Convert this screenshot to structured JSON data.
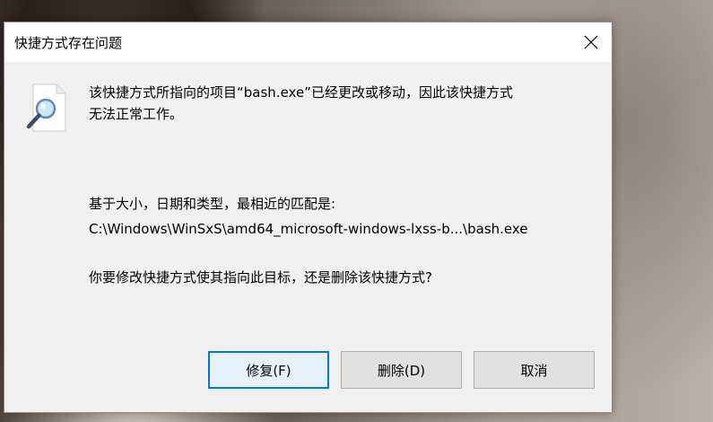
{
  "dialog": {
    "title": "快捷方式存在问题",
    "message_line1": "该快捷方式所指向的项目“bash.exe”已经更改或移动，因此该快捷方式",
    "message_line2": "无法正常工作。",
    "match_label": "基于大小，日期和类型，最相近的匹配是:",
    "match_path": "C:\\Windows\\WinSxS\\amd64_microsoft-windows-lxss-b...\\bash.exe",
    "question": "你要修改快捷方式使其指向此目标，还是删除该快捷方式?",
    "icon": "document-search-icon",
    "close_icon": "close-icon"
  },
  "buttons": {
    "repair": "修复(F)",
    "delete": "删除(D)",
    "cancel": "取消"
  },
  "colors": {
    "accent": "#0078d7",
    "dialog_bg": "#f0f0f0",
    "titlebar_bg": "#ffffff",
    "button_bg": "#e1e1e1"
  }
}
